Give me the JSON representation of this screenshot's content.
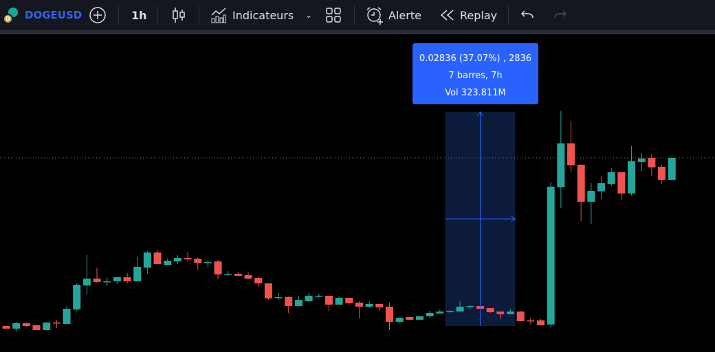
{
  "toolbar": {
    "symbol": "DOGEUSD",
    "interval": "1h",
    "indicators_label": "Indicateurs",
    "alert_label": "Alerte",
    "replay_label": "Replay"
  },
  "measure": {
    "line1": "0.02836 (37.07%) , 2836",
    "line2": "7 barres, 7h",
    "line3": "Vol 323.811M"
  },
  "chart_data": {
    "type": "candlestick",
    "interval": "1h",
    "up_color": "#26a69a",
    "down_color": "#ef5350",
    "last_price": 0.09877,
    "measure_range": {
      "from_bar": 44,
      "to_bar": 50,
      "price_from": 0.0765,
      "price_to": 0.10486
    },
    "ohlc": [
      [
        0.0765,
        0.0765,
        0.07614,
        0.07614
      ],
      [
        0.07614,
        0.07705,
        0.07577,
        0.07686
      ],
      [
        0.07686,
        0.07695,
        0.07641,
        0.0765
      ],
      [
        0.07659,
        0.07659,
        0.07595,
        0.07595
      ],
      [
        0.07595,
        0.07695,
        0.07595,
        0.07695
      ],
      [
        0.07695,
        0.07732,
        0.07623,
        0.07686
      ],
      [
        0.07677,
        0.07914,
        0.07677,
        0.07877
      ],
      [
        0.07868,
        0.08214,
        0.0785,
        0.08195
      ],
      [
        0.08186,
        0.08595,
        0.08068,
        0.08277
      ],
      [
        0.08277,
        0.08423,
        0.08223,
        0.08232
      ],
      [
        0.08232,
        0.08295,
        0.08177,
        0.08241
      ],
      [
        0.08241,
        0.08304,
        0.08204,
        0.08295
      ],
      [
        0.08295,
        0.0835,
        0.08214,
        0.08241
      ],
      [
        0.08241,
        0.08568,
        0.08241,
        0.08432
      ],
      [
        0.08423,
        0.08641,
        0.08341,
        0.08623
      ],
      [
        0.08623,
        0.08659,
        0.08468,
        0.08468
      ],
      [
        0.08459,
        0.08541,
        0.0845,
        0.08514
      ],
      [
        0.08504,
        0.08586,
        0.08468,
        0.0855
      ],
      [
        0.0855,
        0.08632,
        0.08504,
        0.08532
      ],
      [
        0.08541,
        0.08559,
        0.08395,
        0.08486
      ],
      [
        0.08486,
        0.08514,
        0.08432,
        0.08495
      ],
      [
        0.08504,
        0.08523,
        0.08268,
        0.08332
      ],
      [
        0.08332,
        0.08377,
        0.08304,
        0.08341
      ],
      [
        0.08341,
        0.08359,
        0.08314,
        0.08314
      ],
      [
        0.08323,
        0.08359,
        0.08268,
        0.08277
      ],
      [
        0.08286,
        0.08304,
        0.08168,
        0.08214
      ],
      [
        0.08214,
        0.08214,
        0.07995,
        0.08014
      ],
      [
        0.08023,
        0.08086,
        0.07995,
        0.08032
      ],
      [
        0.08032,
        0.08041,
        0.07823,
        0.07914
      ],
      [
        0.07914,
        0.08041,
        0.07905,
        0.07995
      ],
      [
        0.07977,
        0.08086,
        0.07968,
        0.0805
      ],
      [
        0.08041,
        0.08077,
        0.08023,
        0.0805
      ],
      [
        0.0805,
        0.0805,
        0.0785,
        0.07932
      ],
      [
        0.07932,
        0.08041,
        0.07932,
        0.08023
      ],
      [
        0.08023,
        0.08023,
        0.07932,
        0.0795
      ],
      [
        0.07959,
        0.07977,
        0.0775,
        0.07905
      ],
      [
        0.07905,
        0.07977,
        0.07886,
        0.07941
      ],
      [
        0.07941,
        0.07941,
        0.0785,
        0.07895
      ],
      [
        0.07905,
        0.07959,
        0.07595,
        0.07705
      ],
      [
        0.07705,
        0.07759,
        0.07686,
        0.07759
      ],
      [
        0.07768,
        0.07768,
        0.07723,
        0.07732
      ],
      [
        0.07732,
        0.07777,
        0.07732,
        0.07777
      ],
      [
        0.07777,
        0.0785,
        0.07759,
        0.07823
      ],
      [
        0.07814,
        0.07868,
        0.07814,
        0.07841
      ],
      [
        0.07841,
        0.07868,
        0.07823,
        0.0785
      ],
      [
        0.07841,
        0.07977,
        0.07841,
        0.07905
      ],
      [
        0.07905,
        0.07932,
        0.07886,
        0.07914
      ],
      [
        0.07914,
        0.07941,
        0.07877,
        0.07877
      ],
      [
        0.07886,
        0.07886,
        0.07823,
        0.07832
      ],
      [
        0.07841,
        0.07841,
        0.07741,
        0.07805
      ],
      [
        0.07805,
        0.07868,
        0.07805,
        0.07841
      ],
      [
        0.07841,
        0.0785,
        0.07714,
        0.07714
      ],
      [
        0.07723,
        0.07759,
        0.07668,
        0.07714
      ],
      [
        0.07723,
        0.07741,
        0.07659,
        0.07659
      ],
      [
        0.07668,
        0.09559,
        0.07632,
        0.09495
      ],
      [
        0.09486,
        0.10495,
        0.09213,
        0.10068
      ],
      [
        0.10068,
        0.10368,
        0.09686,
        0.09777
      ],
      [
        0.09786,
        0.09786,
        0.09041,
        0.09295
      ],
      [
        0.09295,
        0.09541,
        0.08995,
        0.09441
      ],
      [
        0.09432,
        0.09632,
        0.09332,
        0.09541
      ],
      [
        0.09532,
        0.09741,
        0.09504,
        0.09686
      ],
      [
        0.09686,
        0.09686,
        0.09323,
        0.09404
      ],
      [
        0.09404,
        0.10032,
        0.09377,
        0.09832
      ],
      [
        0.09823,
        0.09941,
        0.09704,
        0.09868
      ],
      [
        0.09877,
        0.09923,
        0.09641,
        0.0975
      ],
      [
        0.09759,
        0.09786,
        0.09532,
        0.09586
      ],
      [
        0.09586,
        0.09877,
        0.09586,
        0.09877
      ]
    ]
  }
}
